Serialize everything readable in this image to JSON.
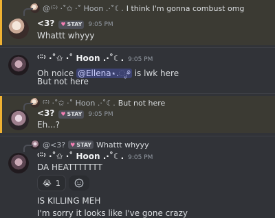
{
  "messages": [
    {
      "reply_prefix": "@",
      "reply_author": "⁽ᵕ̈⁾ ·˚✩ ·˚ Hoon .·˚☾.",
      "reply_text": "I think I'm gonna combust omg",
      "author": "<3?",
      "tag": "STAY",
      "time": "9:05 PM",
      "lines": [
        "Whattt whyyy"
      ]
    },
    {
      "author": "⁽ᵕ̈⁾ ·˚✩ ·˚ Hoon .·˚☾.",
      "time": "9:05 PM",
      "line1_pre": "Oh noice ",
      "mention": "@Ellena⋆.ೃ࿔",
      "line1_post": " is lwk here",
      "line2": "But not here"
    },
    {
      "reply_author": "⁽ᵕ̈⁾ ·˚✩ ·˚ Hoon .·˚☾.",
      "reply_text": "But not here",
      "author": "<3?",
      "tag": "STAY",
      "time": "9:05 PM",
      "lines": [
        "Eh...?"
      ]
    },
    {
      "reply_author": "@<3?",
      "reply_tag": "STAY",
      "reply_text": "Whattt whyyy",
      "author": "⁽ᵕ̈⁾ ·˚✩ ·˚ Hoon .·˚☾.",
      "time": "9:05 PM",
      "lines": [
        "DA HEATTTTTTT",
        "IS KILLING MEH",
        "I'm sorry it looks like I've gone crazy"
      ],
      "reaction": {
        "emoji": "😭",
        "count": "1"
      }
    }
  ],
  "colors": {
    "background": "#313338",
    "highlight": "#3b3a33",
    "highlight_bar": "#f0b232",
    "mention": "#c9cdfb"
  },
  "icons": [
    "reply-spine-icon",
    "heart-icon",
    "add-reaction-icon"
  ]
}
